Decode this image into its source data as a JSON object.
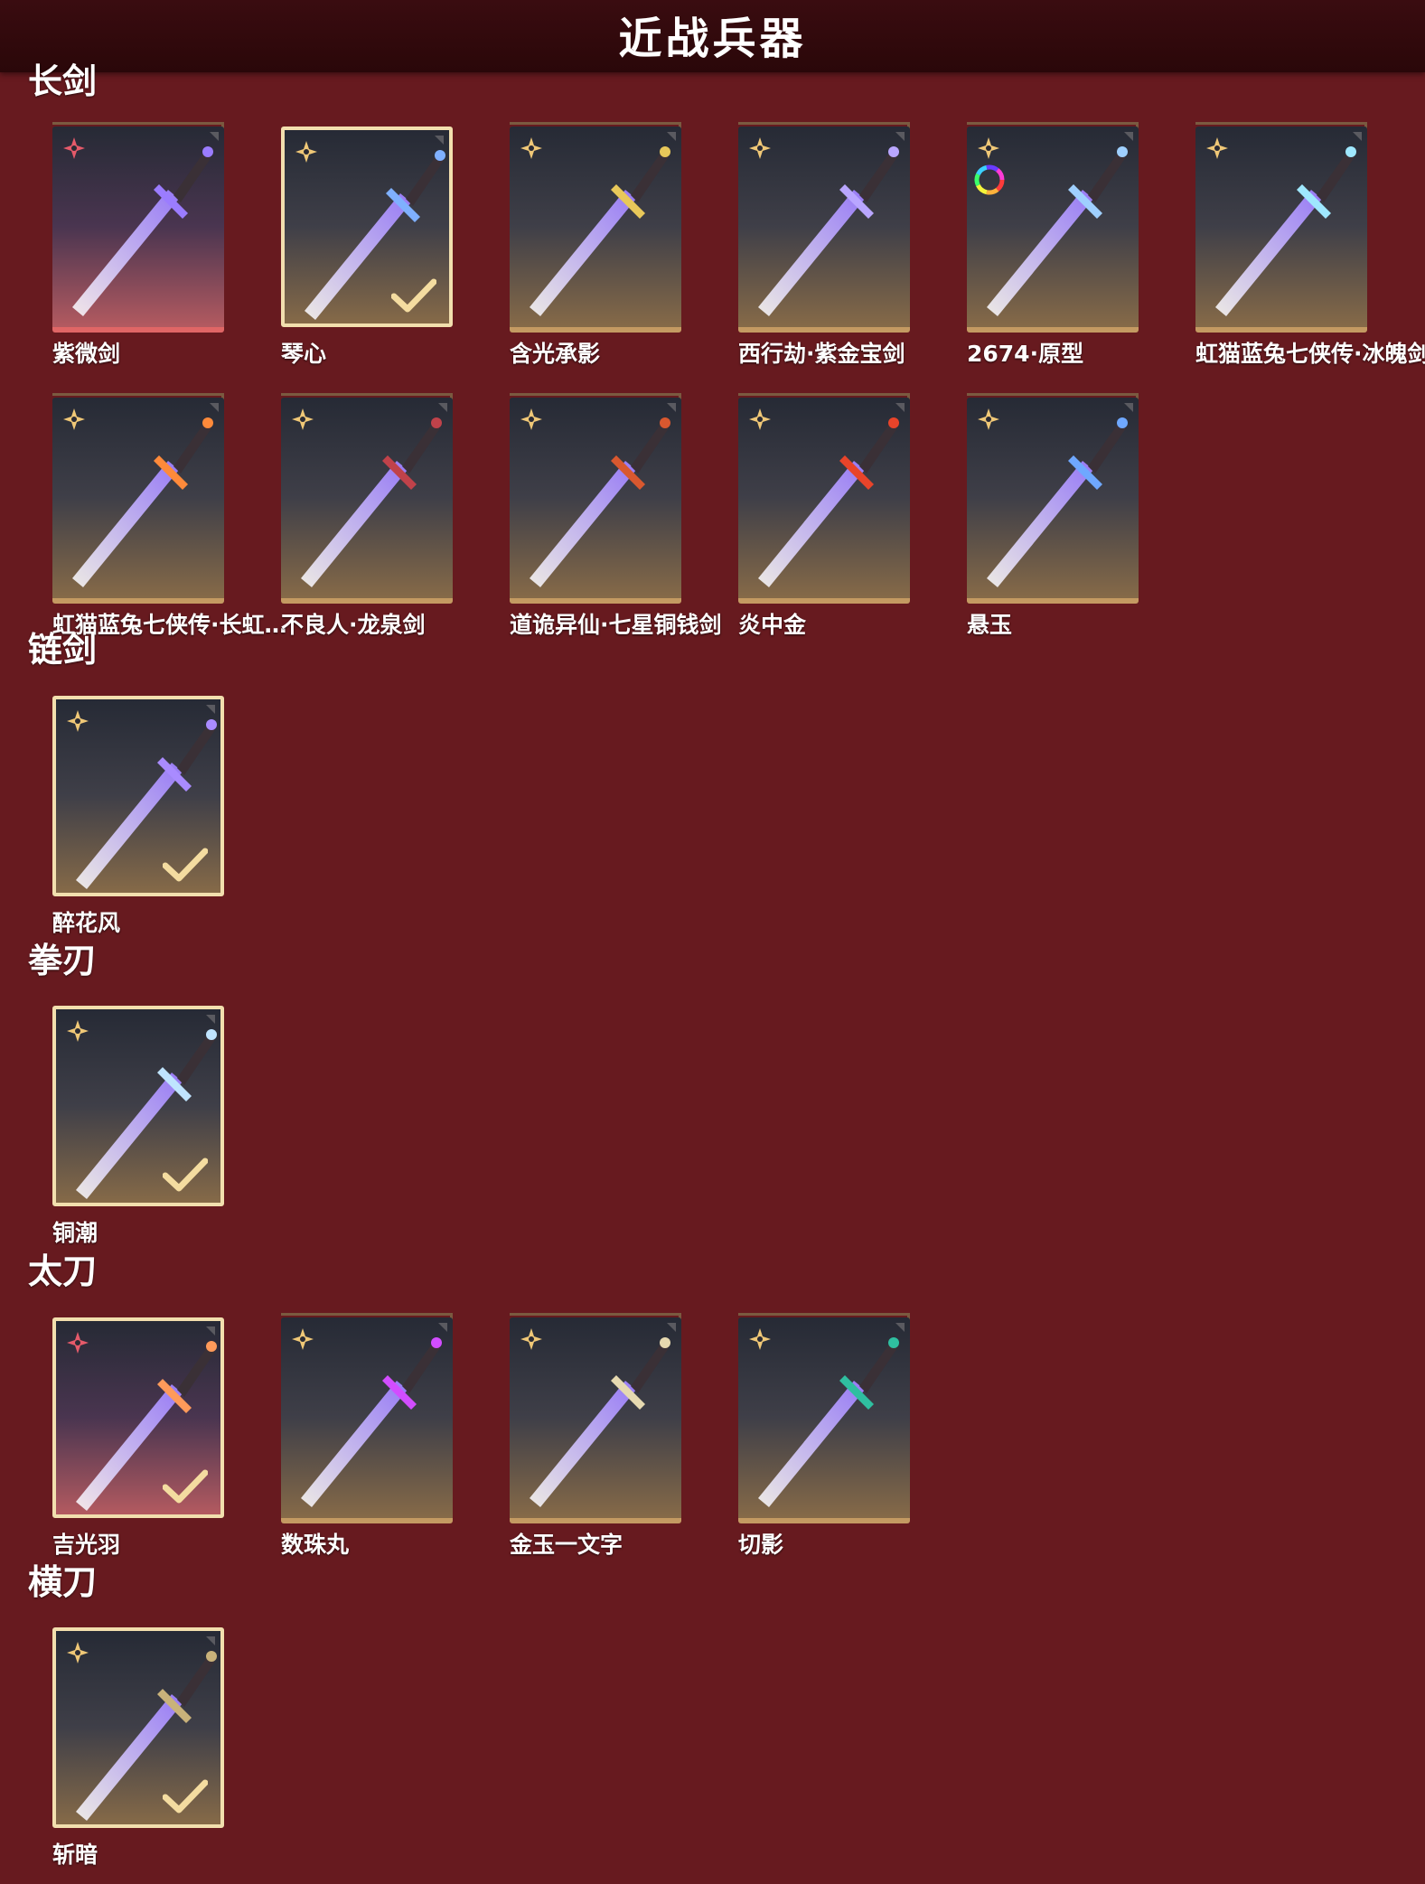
{
  "header": {
    "title": "近战兵器"
  },
  "sections": [
    {
      "title": "长剑",
      "items": [
        {
          "name": "紫微剑",
          "rarity": "pink-star",
          "equipped": false,
          "blade": "#9b7cff"
        },
        {
          "name": "琴心",
          "rarity": "gold-star",
          "equipped": true,
          "blade": "#7fb0ff"
        },
        {
          "name": "含光承影",
          "rarity": "gold-star",
          "equipped": false,
          "blade": "#e8c85a"
        },
        {
          "name": "西行劫·紫金宝剑",
          "rarity": "gold-star",
          "equipped": false,
          "blade": "#b9a6ff"
        },
        {
          "name": "2674·原型",
          "rarity": "gold-star",
          "equipped": false,
          "blade": "#9fd0ff",
          "color_wheel": true
        },
        {
          "name": "虹猫蓝兔七侠传·冰魄剑",
          "rarity": "gold-star",
          "equipped": false,
          "blade": "#9fe8ff"
        }
      ]
    },
    {
      "title": "",
      "items": [
        {
          "name": "虹猫蓝兔七侠传·长虹剑",
          "display": "虹猫蓝兔七侠传·长虹…",
          "rarity": "gold-star",
          "equipped": false,
          "blade": "#ff8a3a"
        },
        {
          "name": "不良人·龙泉剑",
          "rarity": "gold-star",
          "equipped": false,
          "blade": "#c0424a"
        },
        {
          "name": "道诡异仙·七星铜钱剑",
          "rarity": "gold-star",
          "equipped": false,
          "blade": "#d9582f"
        },
        {
          "name": "炎中金",
          "rarity": "gold-star",
          "equipped": false,
          "blade": "#e8442a"
        },
        {
          "name": "悬玉",
          "rarity": "gold-star",
          "equipped": false,
          "blade": "#6fa8ff"
        }
      ]
    },
    {
      "title": "链剑",
      "items": [
        {
          "name": "醉花风",
          "rarity": "gold-star",
          "equipped": true,
          "blade": "#a98bff"
        }
      ]
    },
    {
      "title": "拳刃",
      "items": [
        {
          "name": "铜潮",
          "rarity": "gold-star",
          "equipped": true,
          "blade": "#bfe4ff"
        }
      ]
    },
    {
      "title": "太刀",
      "items": [
        {
          "name": "吉光羽",
          "rarity": "pink-star",
          "equipped": true,
          "blade": "#ff9a5a"
        },
        {
          "name": "数珠丸",
          "rarity": "gold-star",
          "equipped": false,
          "blade": "#d24dff"
        },
        {
          "name": "金玉一文字",
          "rarity": "gold-star",
          "equipped": false,
          "blade": "#e6d9b0"
        },
        {
          "name": "切影",
          "rarity": "gold-star",
          "equipped": false,
          "blade": "#2fbfa0"
        }
      ]
    },
    {
      "title": "横刀",
      "items": [
        {
          "name": "斩暗",
          "rarity": "gold-star",
          "equipped": true,
          "blade": "#c9b27a"
        }
      ]
    }
  ],
  "colors": {
    "background": "#671a1f",
    "header": "#2a0709",
    "gold_star": "#f0c877",
    "pink_star": "#e65a6a",
    "check": "#f4dca0"
  }
}
